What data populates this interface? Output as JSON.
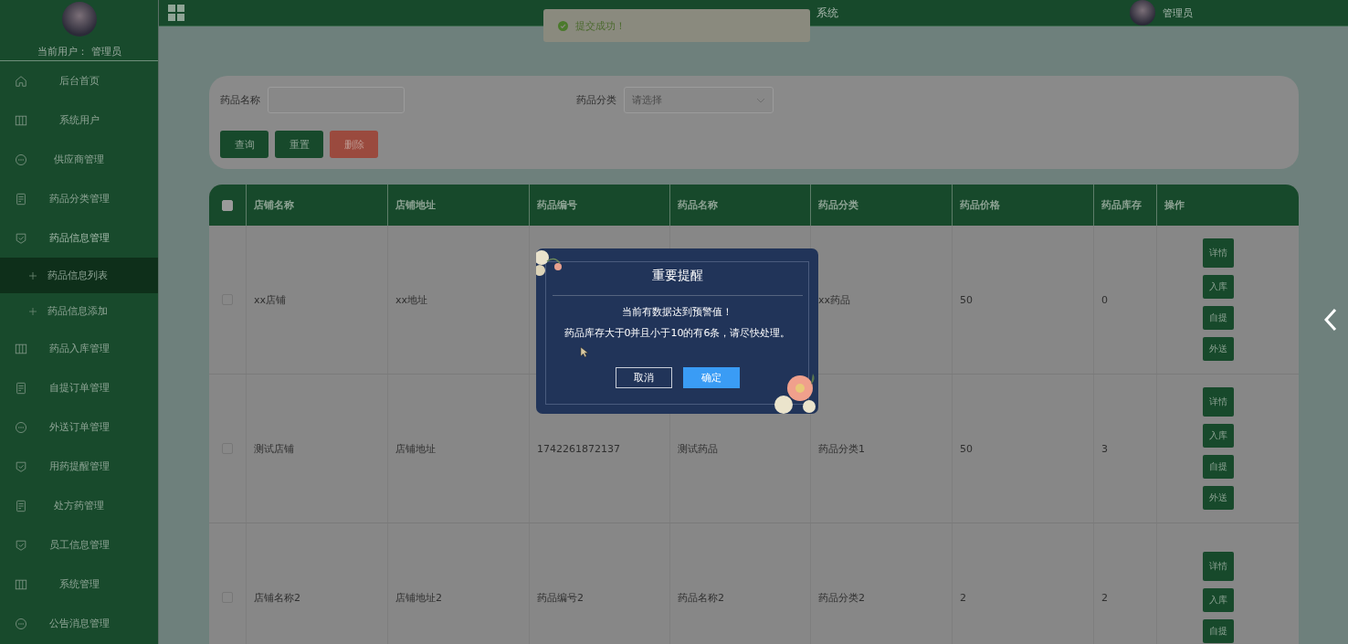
{
  "sidebar": {
    "current_user_label": "当前用户：",
    "current_user": "管理员",
    "items": [
      {
        "label": "后台首页",
        "selected": false
      },
      {
        "label": "系统用户",
        "selected": false
      },
      {
        "label": "供应商管理",
        "selected": false
      },
      {
        "label": "药品分类管理",
        "selected": false
      },
      {
        "label": "药品信息管理",
        "selected": false,
        "expanded": true,
        "children": [
          {
            "label": "药品信息列表",
            "selected": true
          },
          {
            "label": "药品信息添加",
            "selected": false
          }
        ]
      },
      {
        "label": "药品入库管理",
        "selected": false
      },
      {
        "label": "自提订单管理",
        "selected": false
      },
      {
        "label": "外送订单管理",
        "selected": false
      },
      {
        "label": "用药提醒管理",
        "selected": false
      },
      {
        "label": "处方药管理",
        "selected": false
      },
      {
        "label": "员工信息管理",
        "selected": false
      },
      {
        "label": "系统管理",
        "selected": false
      },
      {
        "label": "公告消息管理",
        "selected": false
      }
    ]
  },
  "header": {
    "title": "系统",
    "user": "管理员"
  },
  "toast": {
    "message": "提交成功！"
  },
  "search": {
    "fields": [
      {
        "label": "药品名称",
        "kind": "text"
      },
      {
        "label": "药品分类",
        "kind": "select",
        "placeholder": "请选择"
      }
    ],
    "buttons": [
      {
        "label": "查询",
        "kind": "primary"
      },
      {
        "label": "重置",
        "kind": "primary"
      },
      {
        "label": "删除",
        "kind": "danger"
      }
    ]
  },
  "table": {
    "select_all_checked": false,
    "columns": [
      "店铺名称",
      "店铺地址",
      "药品编号",
      "药品名称",
      "药品分类",
      "药品价格",
      "药品库存",
      "操作"
    ],
    "rows": [
      {
        "checked": false,
        "cells": [
          "xx店铺",
          "xx地址",
          null,
          null,
          "xx药品",
          "50",
          "0"
        ],
        "actions": [
          "详情",
          "入库",
          "自提",
          "外送"
        ]
      },
      {
        "checked": false,
        "cells": [
          "测试店铺",
          "店铺地址",
          "1742261872137",
          "测试药品",
          "药品分类1",
          "50",
          "3"
        ],
        "actions": [
          "详情",
          "入库",
          "自提",
          "外送"
        ]
      },
      {
        "checked": false,
        "cells": [
          "店铺名称2",
          "店铺地址2",
          "药品编号2",
          "药品名称2",
          "药品分类2",
          "2",
          "2"
        ],
        "actions": [
          "详情",
          "入库",
          "自提"
        ]
      }
    ]
  },
  "dialog": {
    "title": "重要提醒",
    "lines": [
      "当前有数据达到预警值！",
      "药品库存大于0并且小于10的有6条，请尽快处理。"
    ],
    "buttons": [
      {
        "label": "取消",
        "kind": "plain"
      },
      {
        "label": "确定",
        "kind": "primary"
      }
    ]
  }
}
